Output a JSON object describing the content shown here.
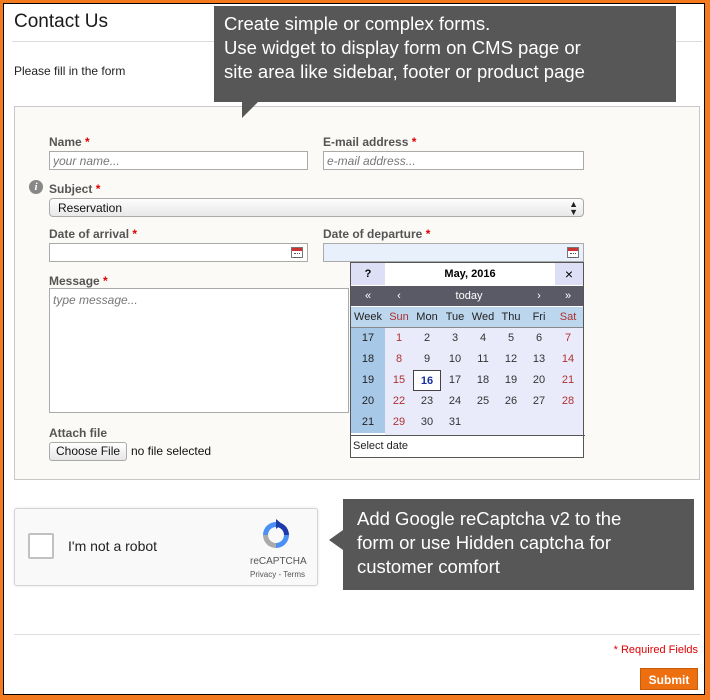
{
  "page": {
    "title": "Contact Us",
    "intro": "Please fill in the form"
  },
  "form": {
    "name_label": "Name",
    "name_placeholder": "your name...",
    "email_label": "E-mail address",
    "email_placeholder": "e-mail address...",
    "subject_label": "Subject",
    "subject_value": "Reservation",
    "arrival_label": "Date of arrival",
    "departure_label": "Date of departure",
    "message_label": "Message",
    "message_placeholder": "type message...",
    "attach_label": "Attach file",
    "choose_file": "Choose File",
    "no_file": "no file selected",
    "required_mark": "*"
  },
  "calendar": {
    "help": "?",
    "month": "May, 2016",
    "close": "×",
    "nav": [
      "«",
      "‹",
      "today",
      "›",
      "»"
    ],
    "days": [
      "Week",
      "Sun",
      "Mon",
      "Tue",
      "Wed",
      "Thu",
      "Fri",
      "Sat"
    ],
    "weeks": [
      [
        "17",
        "1",
        "2",
        "3",
        "4",
        "5",
        "6",
        "7"
      ],
      [
        "18",
        "8",
        "9",
        "10",
        "11",
        "12",
        "13",
        "14"
      ],
      [
        "19",
        "15",
        "16",
        "17",
        "18",
        "19",
        "20",
        "21"
      ],
      [
        "20",
        "22",
        "23",
        "24",
        "25",
        "26",
        "27",
        "28"
      ],
      [
        "21",
        "29",
        "30",
        "31",
        "",
        "",
        "",
        ""
      ]
    ],
    "today": "16",
    "footer": "Select date"
  },
  "tooltips": {
    "forms_line1": "Create simple or complex forms.",
    "forms_line2": "Use widget to display form on CMS page or",
    "forms_line3": "site area like sidebar, footer or product page",
    "captcha_line1": "Add Google reCaptcha v2 to the",
    "captcha_line2": "form or use Hidden captcha for",
    "captcha_line3": "customer comfort"
  },
  "captcha": {
    "label": "I'm not a robot",
    "brand": "reCAPTCHA",
    "privacy": "Privacy",
    "sep": " - ",
    "terms": "Terms"
  },
  "footer": {
    "required_note": "* Required Fields",
    "submit": "Submit"
  },
  "colors": {
    "accent": "#f47a20",
    "submit": "#ee6f10",
    "required": "#dd0000",
    "tooltip": "#575757"
  }
}
